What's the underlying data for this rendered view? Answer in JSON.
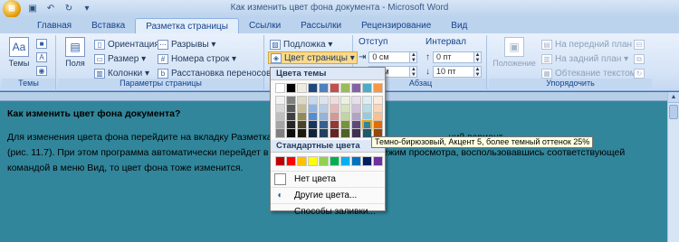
{
  "window": {
    "title": "Как изменить цвет фона документа - Microsoft Word"
  },
  "tabs": [
    "Главная",
    "Вставка",
    "Разметка страницы",
    "Ссылки",
    "Рассылки",
    "Рецензирование",
    "Вид"
  ],
  "ribbon": {
    "themes": {
      "button": "Темы",
      "group_label": "Темы"
    },
    "page_setup": {
      "fields": "Поля",
      "orientation": "Ориентация",
      "size": "Размер",
      "columns": "Колонки",
      "breaks": "Разрывы",
      "line_numbers": "Номера строк",
      "hyphenation": "Расстановка переносов",
      "group_label": "Параметры страницы"
    },
    "background": {
      "watermark": "Подложка",
      "page_color": "Цвет страницы"
    },
    "paragraph": {
      "indent_header": "Отступ",
      "indent_left": "0 см",
      "indent_right": "0 см",
      "spacing_header": "Интервал",
      "spacing_before": "0 пт",
      "spacing_after": "10 пт",
      "group_label": "Абзац"
    },
    "arrange": {
      "position": "Положение",
      "bring_front": "На передний план",
      "send_back": "На задний план",
      "text_wrap": "Обтекание текстом",
      "group_label": "Упорядочить"
    }
  },
  "document": {
    "heading": "Как изменить цвет фона документа?",
    "para1_a": "Для изменения цвета фона перейдите на вкладку Разметка стр",
    "para1_b": "ций вариант",
    "para2_a": "(рис. 11.7). При этом программа автоматически перейдет в ре",
    "para2_b": "змените режим просмотра, воспользовавшись соответствующей",
    "para3": "командой в меню Вид, то цвет фона тоже изменится."
  },
  "dropdown": {
    "theme_colors_label": "Цвета темы",
    "standard_colors_label": "Стандартные цвета",
    "no_color": "Нет цвета",
    "more_colors": "Другие цвета...",
    "fill_effects": "Способы заливки...",
    "theme_top_row": [
      "#ffffff",
      "#000000",
      "#eeece1",
      "#1f497d",
      "#4f81bd",
      "#c0504d",
      "#9bbb59",
      "#8064a2",
      "#4bacc6",
      "#f79646"
    ],
    "theme_shades": [
      [
        "#f2f2f2",
        "#7f7f7f",
        "#ddd9c3",
        "#c6d9f0",
        "#dbe5f1",
        "#f2dcdb",
        "#ebf1dd",
        "#e5e0ec",
        "#dbeef3",
        "#fdeada"
      ],
      [
        "#d8d8d8",
        "#595959",
        "#c4bd97",
        "#8db3e2",
        "#b8cce4",
        "#e5b9b7",
        "#d7e3bc",
        "#ccc1d9",
        "#b7dde8",
        "#fbd5b5"
      ],
      [
        "#bfbfbf",
        "#3f3f3f",
        "#938953",
        "#548dd4",
        "#95b3d7",
        "#d99694",
        "#c3d69b",
        "#b2a2c7",
        "#92cddc",
        "#fac08f"
      ],
      [
        "#a5a5a5",
        "#262626",
        "#494429",
        "#17365d",
        "#366092",
        "#953734",
        "#76923c",
        "#5f497a",
        "#31859b",
        "#e36c09"
      ],
      [
        "#7f7f7f",
        "#0c0c0c",
        "#1d1b10",
        "#0f243e",
        "#244061",
        "#632423",
        "#4f6128",
        "#3f3151",
        "#205867",
        "#974806"
      ]
    ],
    "standard_colors": [
      "#c00000",
      "#ff0000",
      "#ffc000",
      "#ffff00",
      "#92d050",
      "#00b050",
      "#00b0f0",
      "#0070c0",
      "#002060",
      "#7030a0"
    ]
  },
  "tooltip": "Темно-бирюзовый, Акцент 5, более темный оттенок 25%",
  "page_background_color": "#31869b"
}
